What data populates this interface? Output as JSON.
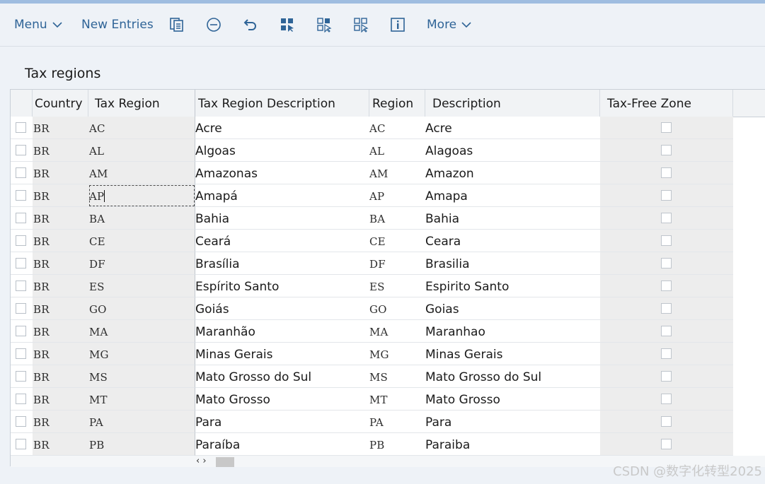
{
  "toolbar": {
    "menu_label": "Menu",
    "new_entries_label": "New Entries",
    "more_label": "More"
  },
  "section_title": "Tax regions",
  "columns": {
    "country": "Country",
    "tax_region": "Tax Region",
    "tax_region_description": "Tax Region Description",
    "region": "Region",
    "description": "Description",
    "tax_free_zone": "Tax-Free Zone"
  },
  "rows": [
    {
      "country": "BR",
      "tax_region": "AC",
      "tax_region_description": "Acre",
      "region": "AC",
      "description": "Acre",
      "tax_free_zone": false
    },
    {
      "country": "BR",
      "tax_region": "AL",
      "tax_region_description": "Algoas",
      "region": "AL",
      "description": "Alagoas",
      "tax_free_zone": false
    },
    {
      "country": "BR",
      "tax_region": "AM",
      "tax_region_description": "Amazonas",
      "region": "AM",
      "description": "Amazon",
      "tax_free_zone": false
    },
    {
      "country": "BR",
      "tax_region": "AP",
      "tax_region_description": "Amapá",
      "region": "AP",
      "description": "Amapa",
      "tax_free_zone": false
    },
    {
      "country": "BR",
      "tax_region": "BA",
      "tax_region_description": "Bahia",
      "region": "BA",
      "description": "Bahia",
      "tax_free_zone": false
    },
    {
      "country": "BR",
      "tax_region": "CE",
      "tax_region_description": "Ceará",
      "region": "CE",
      "description": "Ceara",
      "tax_free_zone": false
    },
    {
      "country": "BR",
      "tax_region": "DF",
      "tax_region_description": "Brasília",
      "region": "DF",
      "description": "Brasilia",
      "tax_free_zone": false
    },
    {
      "country": "BR",
      "tax_region": "ES",
      "tax_region_description": "Espírito Santo",
      "region": "ES",
      "description": "Espirito Santo",
      "tax_free_zone": false
    },
    {
      "country": "BR",
      "tax_region": "GO",
      "tax_region_description": "Goiás",
      "region": "GO",
      "description": "Goias",
      "tax_free_zone": false
    },
    {
      "country": "BR",
      "tax_region": "MA",
      "tax_region_description": "Maranhão",
      "region": "MA",
      "description": "Maranhao",
      "tax_free_zone": false
    },
    {
      "country": "BR",
      "tax_region": "MG",
      "tax_region_description": "Minas Gerais",
      "region": "MG",
      "description": "Minas Gerais",
      "tax_free_zone": false
    },
    {
      "country": "BR",
      "tax_region": "MS",
      "tax_region_description": "Mato Grosso do Sul",
      "region": "MS",
      "description": "Mato Grosso do Sul",
      "tax_free_zone": false
    },
    {
      "country": "BR",
      "tax_region": "MT",
      "tax_region_description": "Mato Grosso",
      "region": "MT",
      "description": "Mato Grosso",
      "tax_free_zone": false
    },
    {
      "country": "BR",
      "tax_region": "PA",
      "tax_region_description": "Para",
      "region": "PA",
      "description": "Para",
      "tax_free_zone": false
    },
    {
      "country": "BR",
      "tax_region": "PB",
      "tax_region_description": "Paraíba",
      "region": "PB",
      "description": "Paraiba",
      "tax_free_zone": false
    }
  ],
  "focused_row": 3,
  "scroll_arrows": "‹ ›",
  "watermark": "CSDN @数字化转型2025",
  "colors": {
    "accent": "#2f6497",
    "readonly_cell": "#ededed"
  }
}
